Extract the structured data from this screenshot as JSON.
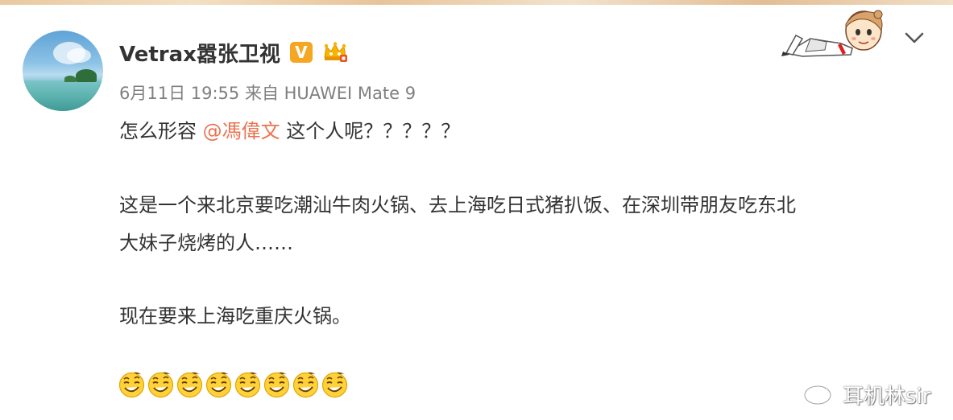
{
  "post": {
    "username": "Vetrax嚣张卫视",
    "verified_badge": "V",
    "member_icon": "crown-icon",
    "meta": "6月11日 19:55 来自 HUAWEI Mate 9",
    "line1_before": "怎么形容 ",
    "mention": "@馮偉文",
    "line1_after": " 这个人呢？？？？？",
    "line2": "这是一个来北京要吃潮汕牛肉火锅、去上海吃日式猪扒饭、在深圳带朋友吃东北",
    "line3": "大妹子烧烤的人……",
    "line4": "现在要来上海吃重庆火锅。",
    "emoji_name": "smirk-emoji",
    "emoji_count": 8
  },
  "watermark": {
    "text": "耳机林sir",
    "icon": "weibo-icon"
  },
  "colors": {
    "text": "#333333",
    "meta": "#808080",
    "mention": "#eb7350",
    "badge": "#f5a623"
  }
}
